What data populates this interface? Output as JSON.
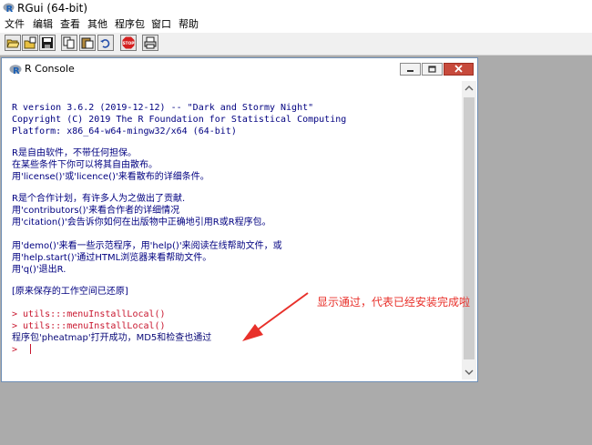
{
  "app": {
    "title": "RGui (64-bit)",
    "icon": "r-logo-icon"
  },
  "menu": [
    "文件",
    "编辑",
    "查看",
    "其他",
    "程序包",
    "窗口",
    "帮助"
  ],
  "toolbar": {
    "buttons": [
      "open-script-icon",
      "load-workspace-icon",
      "save-workspace-icon",
      "copy-icon",
      "paste-icon",
      "copy-paste-icon",
      "stop-icon",
      "print-icon"
    ],
    "stop_label": "STOP"
  },
  "console": {
    "title": "R Console",
    "lines": [
      "R version 3.6.2 (2019-12-12) -- \"Dark and Stormy Night\"",
      "Copyright (C) 2019 The R Foundation for Statistical Computing",
      "Platform: x86_64-w64-mingw32/x64 (64-bit)",
      "R是自由软件，不带任何担保。",
      "在某些条件下你可以将其自由散布。",
      "用'license()'或'licence()'来看散布的详细条件。",
      "R是个合作计划，有许多人为之做出了贡献.",
      "用'contributors()'来看合作者的详细情况",
      "用'citation()'会告诉你如何在出版物中正确地引用R或R程序包。",
      "用'demo()'来看一些示范程序，用'help()'来阅读在线帮助文件，或",
      "用'help.start()'通过HTML浏览器来看帮助文件。",
      "用'q()'退出R.",
      "[原来保存的工作空间已还原]",
      "> utils:::menuInstallLocal()",
      "> utils:::menuInstallLocal()",
      "程序包'pheatmap'打开成功，MD5和检查也通过",
      ">"
    ]
  },
  "annotation": {
    "text": "显示通过，代表已经安装完成啦",
    "color": "#e8302a"
  },
  "colors": {
    "console_text": "#000080",
    "command_text": "#c8162e",
    "background": "#ababab"
  }
}
